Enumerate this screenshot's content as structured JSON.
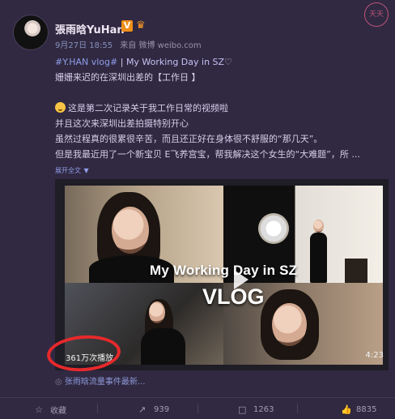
{
  "post": {
    "author": "張雨晗YuHan",
    "verified_badge": "V",
    "date": "9月27日 18:55",
    "source_label": "来自",
    "source": "微博 weibo.com",
    "topic": "#Y.HAN vlog#",
    "topic_separator": " | ",
    "topic_title": "My Working Day in SZ♡",
    "lines": [
      "姗姗来迟的在深圳出差的【工作日 】",
      "",
      "这是第二次记录关于我工作日常的视频啦",
      "并且这次来深圳出差拍摄特别开心",
      "虽然过程真的很累很辛苦，而且还正好在身体很不舒服的“那几天”。",
      "但是我最近用了一个新宝贝 E飞养宫宝，帮我解决这个女生的“大难题”，所 ..."
    ],
    "expand": "展开全文",
    "expand_icon": "chevron-down-icon"
  },
  "video": {
    "title_line1": "My Working Day in SZ",
    "title_line2": "VLOG",
    "play_count": "361万次播放",
    "duration": "4:23",
    "annotation_color": "#e6292c"
  },
  "related": {
    "prefix": "◎",
    "text": "张雨晗流量事件最新..."
  },
  "actions": {
    "favorite": "收藏",
    "share": "939",
    "comment": "1263",
    "like": "8835"
  },
  "watermark": "天天"
}
